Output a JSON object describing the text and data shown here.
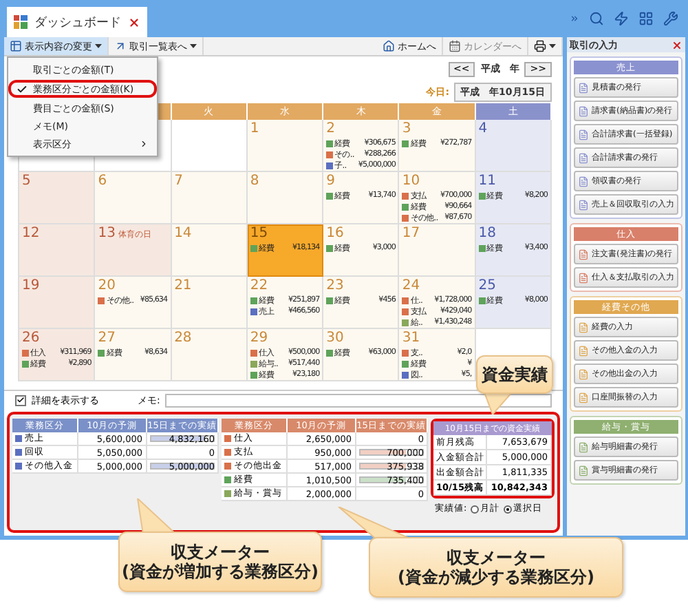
{
  "window": {
    "tab_title": "ダッシュボード"
  },
  "toolbar": {
    "left": [
      {
        "label": "表示内容の変更",
        "open": true
      },
      {
        "label": "取引一覧表へ",
        "open": false
      }
    ],
    "right": [
      {
        "label": "ホームへ",
        "disabled": false
      },
      {
        "label": "カレンダーへ",
        "disabled": true
      }
    ]
  },
  "display_menu": {
    "items": [
      {
        "label": "取引ごとの金額(T)",
        "checked": false,
        "highlighted": false,
        "submenu": false
      },
      {
        "label": "業務区分ごとの金額(K)",
        "checked": true,
        "highlighted": true,
        "submenu": false
      },
      {
        "label": "費目ごとの金額(S)",
        "checked": false,
        "highlighted": false,
        "submenu": false
      },
      {
        "label": "メモ(M)",
        "checked": false,
        "highlighted": false,
        "submenu": false
      },
      {
        "label": "表示区分",
        "checked": false,
        "highlighted": false,
        "submenu": true
      }
    ]
  },
  "calendar": {
    "prev": "<<",
    "year": "平成　年",
    "next": ">>",
    "today_label": "今日:",
    "today_value": "平成　年10月15日",
    "weekdays": [
      {
        "label": "火",
        "kind": "weekday"
      },
      {
        "label": "水",
        "kind": "weekday"
      },
      {
        "label": "木",
        "kind": "weekday"
      },
      {
        "label": "金",
        "kind": "weekday"
      },
      {
        "label": "土",
        "kind": "saturday"
      }
    ],
    "weeks": [
      [
        {
          "kind": "blank"
        },
        {
          "kind": "blank"
        },
        {
          "kind": "blank"
        },
        {
          "kind": "weekday",
          "day": "1"
        },
        {
          "kind": "weekday",
          "day": "2",
          "entries": [
            {
              "label": "経費",
              "amount": "¥306,675",
              "color": "#5fa35a"
            },
            {
              "label": "その..",
              "amount": "¥288,266",
              "color": "#d9704a"
            },
            {
              "label": "子..",
              "amount": "¥5,000,000",
              "color": "#5b6fc0"
            }
          ]
        },
        {
          "kind": "weekday",
          "day": "3",
          "entries": [
            {
              "label": "経費",
              "amount": "¥272,787",
              "color": "#5fa35a"
            }
          ]
        },
        {
          "kind": "saturday",
          "day": "4"
        }
      ],
      [
        {
          "kind": "sunday",
          "day": "5"
        },
        {
          "kind": "weekday",
          "day": "6"
        },
        {
          "kind": "weekday",
          "day": "7"
        },
        {
          "kind": "weekday",
          "day": "8"
        },
        {
          "kind": "weekday",
          "day": "9",
          "entries": [
            {
              "label": "経費",
              "amount": "¥13,740",
              "color": "#5fa35a"
            }
          ]
        },
        {
          "kind": "weekday",
          "day": "10",
          "entries": [
            {
              "label": "支払",
              "amount": "¥700,000",
              "color": "#d9704a"
            },
            {
              "label": "経費",
              "amount": "¥90,664",
              "color": "#5fa35a"
            },
            {
              "label": "その他..",
              "amount": "¥87,670",
              "color": "#d9704a"
            }
          ]
        },
        {
          "kind": "saturday",
          "day": "11",
          "entries": [
            {
              "label": "経費",
              "amount": "¥8,200",
              "color": "#5fa35a"
            }
          ]
        }
      ],
      [
        {
          "kind": "sunday",
          "day": "12"
        },
        {
          "kind": "holiday",
          "day": "13",
          "holiday": "体育の日"
        },
        {
          "kind": "weekday",
          "day": "14"
        },
        {
          "kind": "today",
          "day": "15",
          "entries": [
            {
              "label": "経費",
              "amount": "¥18,134",
              "color": "#5fa35a"
            }
          ]
        },
        {
          "kind": "weekday",
          "day": "16",
          "entries": [
            {
              "label": "経費",
              "amount": "¥3,000",
              "color": "#5fa35a"
            }
          ]
        },
        {
          "kind": "weekday",
          "day": "17"
        },
        {
          "kind": "saturday",
          "day": "18",
          "entries": [
            {
              "label": "経費",
              "amount": "¥3,400",
              "color": "#5fa35a"
            }
          ]
        }
      ],
      [
        {
          "kind": "sunday",
          "day": "19"
        },
        {
          "kind": "weekday",
          "day": "20",
          "entries": [
            {
              "label": "その他..",
              "amount": "¥85,634",
              "color": "#d9704a"
            }
          ]
        },
        {
          "kind": "weekday",
          "day": "21"
        },
        {
          "kind": "weekday",
          "day": "22",
          "entries": [
            {
              "label": "経費",
              "amount": "¥251,897",
              "color": "#5fa35a"
            },
            {
              "label": "売上",
              "amount": "¥466,560",
              "color": "#5b6fc0"
            }
          ]
        },
        {
          "kind": "weekday",
          "day": "23",
          "entries": [
            {
              "label": "経費",
              "amount": "¥456",
              "color": "#5fa35a"
            }
          ]
        },
        {
          "kind": "weekday",
          "day": "24",
          "entries": [
            {
              "label": "仕..",
              "amount": "¥1,728,000",
              "color": "#d9704a"
            },
            {
              "label": "支払",
              "amount": "¥429,040",
              "color": "#d9704a"
            },
            {
              "label": "給..",
              "amount": "¥1,430,248",
              "color": "#8aa85a"
            }
          ]
        },
        {
          "kind": "saturday",
          "day": "25",
          "entries": [
            {
              "label": "経費",
              "amount": "¥8,000",
              "color": "#5fa35a"
            }
          ]
        }
      ],
      [
        {
          "kind": "sunday",
          "day": "26",
          "entries": [
            {
              "label": "仕入",
              "amount": "¥311,969",
              "color": "#d9704a"
            },
            {
              "label": "経費",
              "amount": "¥2,890",
              "color": "#5fa35a"
            }
          ]
        },
        {
          "kind": "weekday",
          "day": "27",
          "entries": [
            {
              "label": "経費",
              "amount": "¥8,634",
              "color": "#5fa35a"
            }
          ]
        },
        {
          "kind": "weekday",
          "day": "28"
        },
        {
          "kind": "weekday",
          "day": "29",
          "entries": [
            {
              "label": "仕入",
              "amount": "¥500,000",
              "color": "#d9704a"
            },
            {
              "label": "給与..",
              "amount": "¥517,440",
              "color": "#8aa85a"
            },
            {
              "label": "経費",
              "amount": "¥23,180",
              "color": "#5fa35a"
            }
          ]
        },
        {
          "kind": "weekday",
          "day": "30",
          "entries": [
            {
              "label": "経費",
              "amount": "¥63,000",
              "color": "#5fa35a"
            }
          ]
        },
        {
          "kind": "weekday",
          "day": "31",
          "entries": [
            {
              "label": "支..",
              "amount": "¥2,0",
              "color": "#d9704a"
            },
            {
              "label": "経費",
              "amount": "¥",
              "color": "#5fa35a"
            },
            {
              "label": "図..",
              "amount": "¥5,",
              "color": "#5b6fc0"
            }
          ]
        },
        {
          "kind": "blank"
        }
      ]
    ]
  },
  "details": {
    "label": "詳細を表示する",
    "checked": true,
    "memo_label": "メモ:"
  },
  "income_meter": {
    "columns": [
      "業務区分",
      "10月の予測",
      "15日までの実績"
    ],
    "rows": [
      {
        "category": "売上",
        "forecast": "5,600,000",
        "actual": "4,832,160",
        "level": 0.86,
        "color": "#5b6fc0"
      },
      {
        "category": "回収",
        "forecast": "5,050,000",
        "actual": "0",
        "level": 0,
        "color": "#5b6fc0"
      },
      {
        "category": "その他入金",
        "forecast": "5,000,000",
        "actual": "5,000,000",
        "level": 1,
        "color": "#5b6fc0"
      }
    ]
  },
  "expense_meter": {
    "columns": [
      "業務区分",
      "10月の予測",
      "15日までの実績"
    ],
    "rows": [
      {
        "category": "仕入",
        "forecast": "2,650,000",
        "actual": "0",
        "level": 0,
        "color": "#d9704a"
      },
      {
        "category": "支払",
        "forecast": "950,000",
        "actual": "700,000",
        "level": 0.74,
        "color": "#d9704a"
      },
      {
        "category": "その他出金",
        "forecast": "517,000",
        "actual": "375,938",
        "level": 0.73,
        "color": "#d9704a"
      },
      {
        "category": "経費",
        "forecast": "1,010,500",
        "actual": "735,400",
        "level": 0.73,
        "color": "#5fa35a"
      },
      {
        "category": "給与・賞与",
        "forecast": "2,000,000",
        "actual": "0",
        "level": 0,
        "color": "#8aa85a"
      }
    ]
  },
  "cash_results": {
    "title": "10月15日までの資金実績",
    "rows": [
      {
        "label": "前月残高",
        "value": "7,653,679",
        "total": false
      },
      {
        "label": "入金額合計",
        "value": "5,000,000",
        "total": false
      },
      {
        "label": "出金額合計",
        "value": "1,811,335",
        "total": false
      },
      {
        "label": "10/15残高",
        "value": "10,842,343",
        "total": true
      }
    ],
    "basis_label": "実績値:",
    "options": [
      {
        "label": "月計",
        "selected": false
      },
      {
        "label": "選択日",
        "selected": true
      }
    ]
  },
  "entry_panel": {
    "title": "取引の入力",
    "sections": [
      {
        "title": "売上",
        "color": "#8b92d0",
        "buttons": [
          "見積書の発行",
          "請求書(納品書)の発行",
          "合計請求書(一括登録)",
          "合計請求書の発行",
          "領収書の発行",
          "売上＆回収取引の入力"
        ]
      },
      {
        "title": "仕入",
        "color": "#d9806a",
        "buttons": [
          "注文書(発注書)の発行",
          "仕入＆支払取引の入力"
        ]
      },
      {
        "title": "経費その他",
        "color": "#e0a850",
        "buttons": [
          "経費の入力",
          "その他入金の入力",
          "その他出金の入力",
          "口座間振替の入力"
        ]
      },
      {
        "title": "給与・賞与",
        "color": "#8fb070",
        "buttons": [
          "給与明細書の発行",
          "賞与明細書の発行"
        ]
      }
    ]
  },
  "callouts": [
    {
      "text": "資金実績"
    },
    {
      "text": "収支メーター\n(資金が増加する業務区分)"
    },
    {
      "text": "収支メーター\n(資金が減少する業務区分)"
    }
  ]
}
